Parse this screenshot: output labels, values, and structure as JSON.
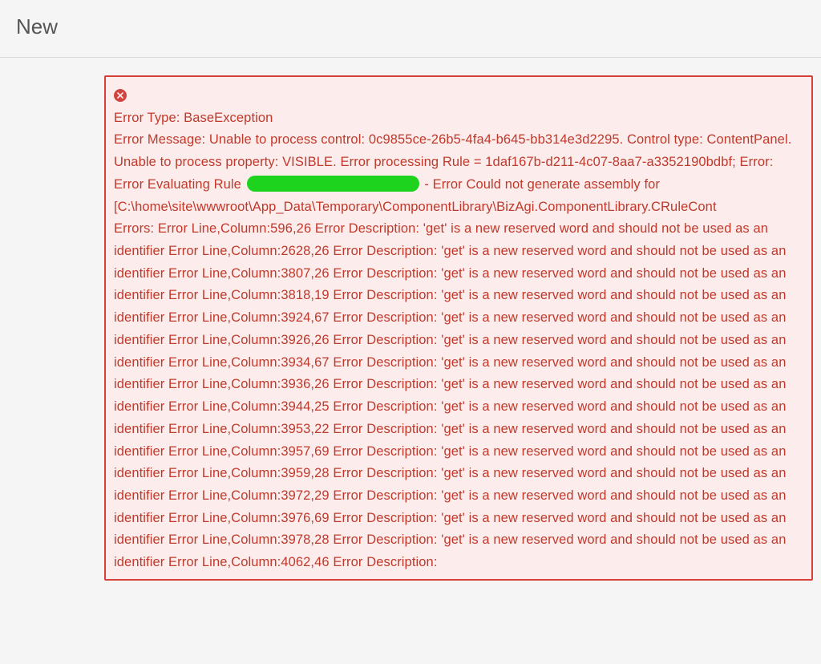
{
  "header": {
    "title": "New"
  },
  "error": {
    "close_label": "close",
    "type_line": "Error Type: BaseException",
    "msg_part1": "Error Message: Unable to process control: 0c9855ce-26b5-4fa4-b645-bb314e3d2295. Control type: ContentPanel. Unable to process property: VISIBLE. Error processing Rule = 1daf167b-d211-4c07-8aa7-a3352190bdbf; Error: Error Evaluating Rule",
    "msg_part2": " - Error Could not generate assembly for",
    "path_line": "[C:\\home\\site\\wwwroot\\App_Data\\Temporary\\ComponentLibrary\\BizAgi.ComponentLibrary.CRuleCont",
    "errors_block": "Errors: Error Line,Column:596,26 Error Description: 'get' is a new reserved word and should not be used as an identifier Error Line,Column:2628,26 Error Description: 'get' is a new reserved word and should not be used as an identifier Error Line,Column:3807,26 Error Description: 'get' is a new reserved word and should not be used as an identifier Error Line,Column:3818,19 Error Description: 'get' is a new reserved word and should not be used as an identifier Error Line,Column:3924,67 Error Description: 'get' is a new reserved word and should not be used as an identifier Error Line,Column:3926,26 Error Description: 'get' is a new reserved word and should not be used as an identifier Error Line,Column:3934,67 Error Description: 'get' is a new reserved word and should not be used as an identifier Error Line,Column:3936,26 Error Description: 'get' is a new reserved word and should not be used as an identifier Error Line,Column:3944,25 Error Description: 'get' is a new reserved word and should not be used as an identifier Error Line,Column:3953,22 Error Description: 'get' is a new reserved word and should not be used as an identifier Error Line,Column:3957,69 Error Description: 'get' is a new reserved word and should not be used as an identifier Error Line,Column:3959,28 Error Description: 'get' is a new reserved word and should not be used as an identifier Error Line,Column:3972,29 Error Description: 'get' is a new reserved word and should not be used as an identifier Error Line,Column:3976,69 Error Description: 'get' is a new reserved word and should not be used as an identifier Error Line,Column:3978,28 Error Description: 'get' is a new reserved word and should not be used as an identifier Error Line,Column:4062,46 Error Description:"
  }
}
